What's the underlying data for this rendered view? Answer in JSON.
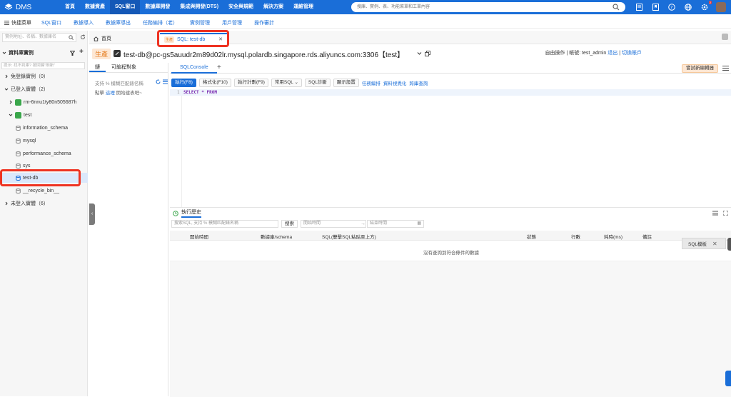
{
  "app": {
    "name": "DMS"
  },
  "topnav": [
    "首頁",
    "數據資產",
    "SQL窗口",
    "數據庫開發",
    "集成與開發(DTS)",
    "安全與規範",
    "解決方案",
    "運維管理"
  ],
  "topnav_active": "SQL窗口",
  "search": {
    "placeholder": "搜庫、實例、表、功能菜單和工單內容"
  },
  "notification_count": "2",
  "subbar": {
    "quick_menu": "快捷菜單",
    "links": [
      "SQL窗口",
      "數據導入",
      "數據庫導出",
      "任務編排（老）",
      "實例管理",
      "用戶管理",
      "操作審計"
    ]
  },
  "left": {
    "search_placeholder": "實例地址、名稱、數據庫名",
    "header": "資料庫實例",
    "tip": "提示: 找不到庫? 按回鍵\"刷新\"",
    "tree": {
      "free_login": "免登錄實例（0）",
      "logged_in": "已登入實體（2）",
      "instance1": "rm-6nnu1ty80n505687h",
      "instance2": "test",
      "dbs": [
        "information_schema",
        "mysql",
        "performance_schema",
        "sys",
        "test-db",
        "__recycle_bin__"
      ],
      "not_logged": "未登入實體（6）"
    }
  },
  "tabs": {
    "home": "首頁",
    "sql_tag": "生產",
    "sql_tab": "SQL: test-db"
  },
  "connection": {
    "env": "生產",
    "text": "test-db@pc-gs5auudr2m89d02lr.mysql.polardb.singapore.rds.aliyuncs.com:3306【test】",
    "mode_prefix": "自由操作 | 帳號: test_admin",
    "logout": "退出",
    "switch": "切換賬戶"
  },
  "objects": {
    "tab_table": "鏈",
    "tab_programmable": "可編程對象",
    "search_hint": "支持 % 模糊匹配錶名稱",
    "hint_prefix": "點擊",
    "hint_link": "這裡",
    "hint_suffix": "開始建表吧~"
  },
  "editor": {
    "tab": "SQLConsole",
    "try_new": "嘗試新編輯器",
    "toolbar": {
      "run": "執行(F8)",
      "format": "格式化(F10)",
      "plan": "執行計劃(F9)",
      "common_sql": "常用SQL",
      "diagnose": "SQL診斷",
      "display": "顯示設置",
      "links": [
        "任務編排",
        "資料視覺化",
        "跨庫查詢"
      ]
    },
    "line_number": "1",
    "code": "SELECT * FROM"
  },
  "history": {
    "title": "執行歷史",
    "search_placeholder": "搜索SQL, 支持 % 模糊匹配錶名稱",
    "search_btn": "搜索",
    "start_time_placeholder": "開始時間",
    "end_time_placeholder": "結束時間",
    "columns": [
      "開始時間",
      "數據庫/schema",
      "SQL(雙擊SQL粘貼至上方)",
      "狀態",
      "行數",
      "耗時(ms)",
      "備註"
    ],
    "empty": "沒有查詢到符合條件的數據"
  },
  "sql_template": "SQL模板",
  "colors": {
    "brand": "#1a6ed8",
    "highlight": "#ee3322",
    "env_tag": "#e67e22"
  }
}
